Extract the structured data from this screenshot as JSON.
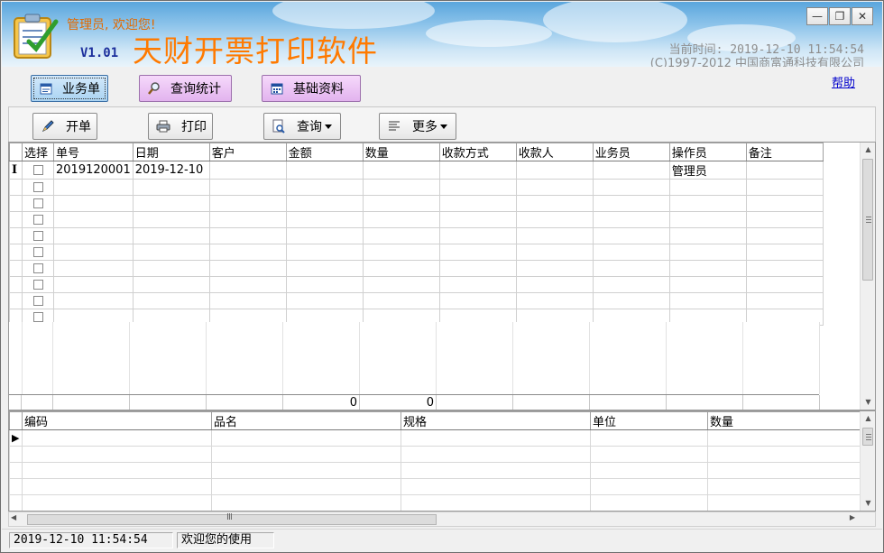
{
  "header": {
    "welcome": "管理员, 欢迎您!",
    "version": "V1.01",
    "title": "天财开票打印软件",
    "clock": "当前时间: 2019-12-10 11:54:54",
    "copyright": "(C)1997-2012 中国商富通科技有限公司"
  },
  "window_controls": {
    "minimize": "—",
    "restore": "❐",
    "close": "✕"
  },
  "nav": {
    "items": [
      {
        "label": "业务单",
        "icon": "form-icon"
      },
      {
        "label": "查询统计",
        "icon": "magnifier-icon"
      },
      {
        "label": "基础资料",
        "icon": "calendar-grid-icon"
      }
    ],
    "help": "帮助"
  },
  "toolbar": {
    "new": "开单",
    "print": "打印",
    "query": "查询",
    "more": "更多"
  },
  "grid": {
    "columns": [
      "选择",
      "单号",
      "日期",
      "客户",
      "金额",
      "数量",
      "收款方式",
      "收款人",
      "业务员",
      "操作员",
      "备注"
    ],
    "rows": [
      {
        "checked": false,
        "number": "2019120001",
        "date": "2019-12-10",
        "customer": "",
        "amount": "",
        "qty": "",
        "pay_method": "",
        "payee": "",
        "salesman": "",
        "operator": "管理员",
        "note": ""
      }
    ],
    "empty_rows": 9,
    "current_row_marker": "I",
    "totals": {
      "amount": "0",
      "qty": "0"
    }
  },
  "detail": {
    "columns": [
      "编码",
      "品名",
      "规格",
      "单位",
      "数量"
    ],
    "current_row_marker": "▶"
  },
  "scrollbar": {
    "grip": "Ⅲ"
  },
  "status": {
    "datetime": "2019-12-10 11:54:54",
    "message": "欢迎您的使用"
  },
  "colors": {
    "title": "#ff7a00",
    "version": "#1c2f9c",
    "help_link": "#0000cc"
  }
}
